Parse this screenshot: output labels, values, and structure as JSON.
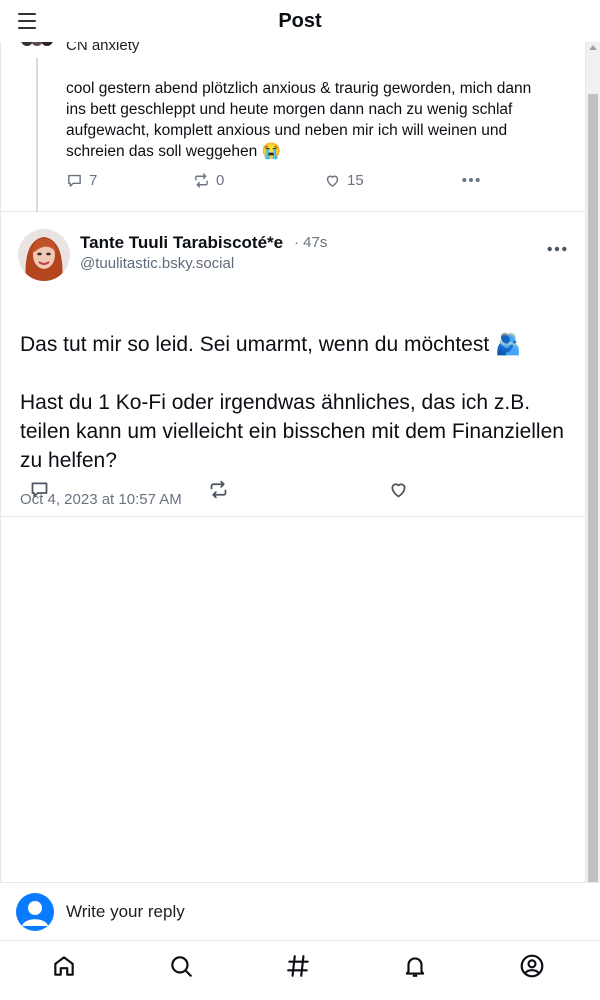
{
  "header": {
    "title": "Post",
    "menu_icon": "hamburger-menu-icon"
  },
  "parent_post": {
    "content_warning": "CN anxiety",
    "text_lines": [
      "cool gestern abend plötzlich anxious & traurig geworden, mich dann",
      "ins bett geschleppt und heute morgen dann nach zu wenig schlaf",
      "aufgewacht, komplett anxious und neben mir ich will weinen und",
      "schreien das soll weggehen 😭"
    ],
    "reply_count": "7",
    "repost_count": "0",
    "like_count": "15"
  },
  "main_post": {
    "author_name": "Tante Tuuli Tarabiscoté*e",
    "age": "· 47s",
    "handle": "@tuulitastic.bsky.social",
    "text_paragraph_1": "Das tut mir so leid. Sei umarmt, wenn du möchtest 🫂",
    "text_paragraph_2": "Hast du 1 Ko-Fi oder irgendwas ähnliches, das ich z.B. teilen kann um vielleicht ein bisschen mit dem Finanziellen zu helfen?",
    "timestamp": "Oct 4, 2023 at 10:57 AM"
  },
  "reply_bar": {
    "placeholder": "Write your reply"
  },
  "bottom_nav": {
    "items": [
      "home-icon",
      "search-icon",
      "hashtag-feeds-icon",
      "notifications-bell-icon",
      "profile-icon"
    ]
  },
  "colors": {
    "accent": "#0a7aff",
    "muted_text": "#6a7480",
    "border": "#e6e8ea"
  }
}
